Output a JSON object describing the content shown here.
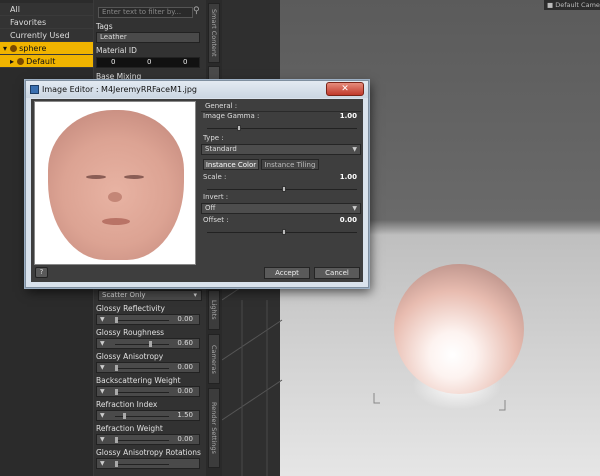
{
  "tree": {
    "items": [
      {
        "label": "All"
      },
      {
        "label": "Favorites"
      },
      {
        "label": "Currently Used"
      },
      {
        "label": "sphere"
      },
      {
        "label": "Default"
      }
    ]
  },
  "filter": {
    "placeholder": "Enter text to filter by..."
  },
  "properties": {
    "tags_label": "Tags",
    "tags_value": "Leather",
    "material_id_label": "Material ID",
    "material_id_values": [
      "0",
      "0",
      "0"
    ],
    "base_mixing_label": "Base Mixing",
    "scatter_value": "Scatter Only",
    "items": [
      {
        "label": "Glossy Reflectivity",
        "value": "0.00",
        "level": 0.0
      },
      {
        "label": "Glossy Roughness",
        "value": "0.60",
        "level": 0.6
      },
      {
        "label": "Glossy Anisotropy",
        "value": "0.00",
        "level": 0.0
      },
      {
        "label": "Backscattering Weight",
        "value": "0.00",
        "level": 0.0
      },
      {
        "label": "Refraction Index",
        "value": "1.50",
        "level": 0.15
      },
      {
        "label": "Refraction Weight",
        "value": "0.00",
        "level": 0.0
      },
      {
        "label": "Glossy Anisotropy Rotations",
        "value": "",
        "level": 0.0
      }
    ]
  },
  "vtabs": [
    "Smart Content",
    "Surfaces",
    "Lights",
    "Cameras",
    "Render Settings"
  ],
  "viewport": {
    "camera_label": "Default Camera"
  },
  "dialog": {
    "title": "Image Editor : M4JeremyRRFaceM1.jpg",
    "close_glyph": "✕",
    "general_label": "General :",
    "gamma_label": "Image Gamma :",
    "gamma_value": "1.00",
    "gamma_level": 0.2,
    "type_label": "Type :",
    "type_value": "Standard",
    "tab_color": "Instance Color",
    "tab_tiling": "Instance Tiling",
    "scale_label": "Scale :",
    "scale_value": "1.00",
    "scale_level": 0.5,
    "invert_label": "Invert :",
    "invert_value": "Off",
    "offset_label": "Offset :",
    "offset_value": "0.00",
    "offset_level": 0.5,
    "help_glyph": "?",
    "accept_label": "Accept",
    "cancel_label": "Cancel"
  }
}
